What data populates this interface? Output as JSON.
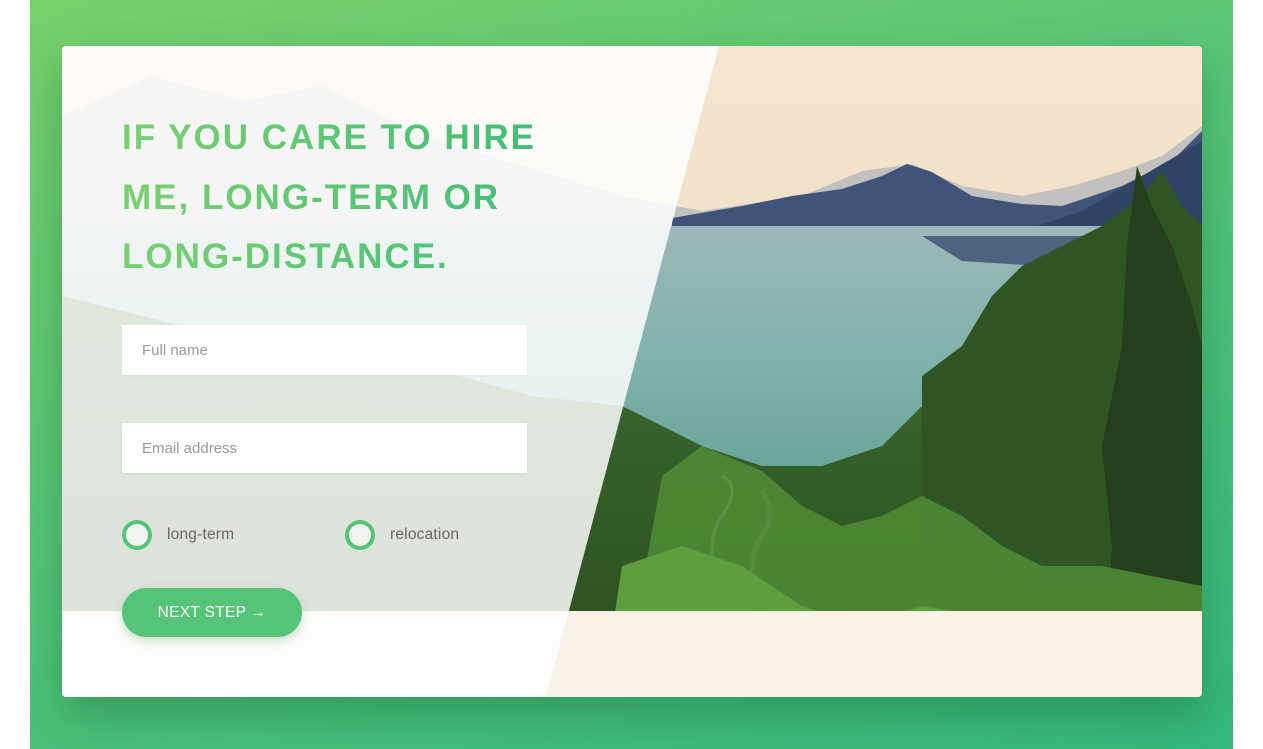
{
  "form": {
    "headline_lines": [
      "IF YOU CARE TO HIRE",
      "ME, LONG-TERM OR",
      "LONG-DISTANCE."
    ],
    "full_name_placeholder": "Full name",
    "email_placeholder": "Email address",
    "radio_options": [
      {
        "label": "long-term"
      },
      {
        "label": "relocation"
      }
    ],
    "next_button_label": "NEXT STEP →"
  },
  "colors": {
    "accent": "#56c478",
    "background_gradient_start": "#77d06c",
    "background_gradient_end": "#33b77b"
  },
  "icons": {
    "radio": "circle-outline"
  }
}
